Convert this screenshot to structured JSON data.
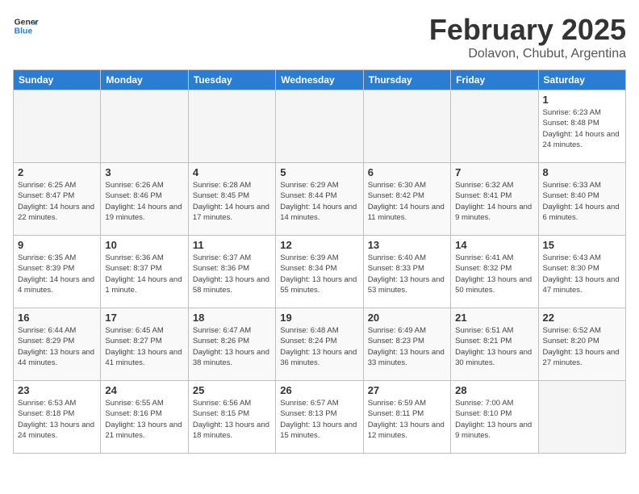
{
  "header": {
    "logo_line1": "General",
    "logo_line2": "Blue",
    "title": "February 2025",
    "subtitle": "Dolavon, Chubut, Argentina"
  },
  "weekdays": [
    "Sunday",
    "Monday",
    "Tuesday",
    "Wednesday",
    "Thursday",
    "Friday",
    "Saturday"
  ],
  "weeks": [
    [
      {
        "day": "",
        "info": ""
      },
      {
        "day": "",
        "info": ""
      },
      {
        "day": "",
        "info": ""
      },
      {
        "day": "",
        "info": ""
      },
      {
        "day": "",
        "info": ""
      },
      {
        "day": "",
        "info": ""
      },
      {
        "day": "1",
        "info": "Sunrise: 6:23 AM\nSunset: 8:48 PM\nDaylight: 14 hours and 24 minutes."
      }
    ],
    [
      {
        "day": "2",
        "info": "Sunrise: 6:25 AM\nSunset: 8:47 PM\nDaylight: 14 hours and 22 minutes."
      },
      {
        "day": "3",
        "info": "Sunrise: 6:26 AM\nSunset: 8:46 PM\nDaylight: 14 hours and 19 minutes."
      },
      {
        "day": "4",
        "info": "Sunrise: 6:28 AM\nSunset: 8:45 PM\nDaylight: 14 hours and 17 minutes."
      },
      {
        "day": "5",
        "info": "Sunrise: 6:29 AM\nSunset: 8:44 PM\nDaylight: 14 hours and 14 minutes."
      },
      {
        "day": "6",
        "info": "Sunrise: 6:30 AM\nSunset: 8:42 PM\nDaylight: 14 hours and 11 minutes."
      },
      {
        "day": "7",
        "info": "Sunrise: 6:32 AM\nSunset: 8:41 PM\nDaylight: 14 hours and 9 minutes."
      },
      {
        "day": "8",
        "info": "Sunrise: 6:33 AM\nSunset: 8:40 PM\nDaylight: 14 hours and 6 minutes."
      }
    ],
    [
      {
        "day": "9",
        "info": "Sunrise: 6:35 AM\nSunset: 8:39 PM\nDaylight: 14 hours and 4 minutes."
      },
      {
        "day": "10",
        "info": "Sunrise: 6:36 AM\nSunset: 8:37 PM\nDaylight: 14 hours and 1 minute."
      },
      {
        "day": "11",
        "info": "Sunrise: 6:37 AM\nSunset: 8:36 PM\nDaylight: 13 hours and 58 minutes."
      },
      {
        "day": "12",
        "info": "Sunrise: 6:39 AM\nSunset: 8:34 PM\nDaylight: 13 hours and 55 minutes."
      },
      {
        "day": "13",
        "info": "Sunrise: 6:40 AM\nSunset: 8:33 PM\nDaylight: 13 hours and 53 minutes."
      },
      {
        "day": "14",
        "info": "Sunrise: 6:41 AM\nSunset: 8:32 PM\nDaylight: 13 hours and 50 minutes."
      },
      {
        "day": "15",
        "info": "Sunrise: 6:43 AM\nSunset: 8:30 PM\nDaylight: 13 hours and 47 minutes."
      }
    ],
    [
      {
        "day": "16",
        "info": "Sunrise: 6:44 AM\nSunset: 8:29 PM\nDaylight: 13 hours and 44 minutes."
      },
      {
        "day": "17",
        "info": "Sunrise: 6:45 AM\nSunset: 8:27 PM\nDaylight: 13 hours and 41 minutes."
      },
      {
        "day": "18",
        "info": "Sunrise: 6:47 AM\nSunset: 8:26 PM\nDaylight: 13 hours and 38 minutes."
      },
      {
        "day": "19",
        "info": "Sunrise: 6:48 AM\nSunset: 8:24 PM\nDaylight: 13 hours and 36 minutes."
      },
      {
        "day": "20",
        "info": "Sunrise: 6:49 AM\nSunset: 8:23 PM\nDaylight: 13 hours and 33 minutes."
      },
      {
        "day": "21",
        "info": "Sunrise: 6:51 AM\nSunset: 8:21 PM\nDaylight: 13 hours and 30 minutes."
      },
      {
        "day": "22",
        "info": "Sunrise: 6:52 AM\nSunset: 8:20 PM\nDaylight: 13 hours and 27 minutes."
      }
    ],
    [
      {
        "day": "23",
        "info": "Sunrise: 6:53 AM\nSunset: 8:18 PM\nDaylight: 13 hours and 24 minutes."
      },
      {
        "day": "24",
        "info": "Sunrise: 6:55 AM\nSunset: 8:16 PM\nDaylight: 13 hours and 21 minutes."
      },
      {
        "day": "25",
        "info": "Sunrise: 6:56 AM\nSunset: 8:15 PM\nDaylight: 13 hours and 18 minutes."
      },
      {
        "day": "26",
        "info": "Sunrise: 6:57 AM\nSunset: 8:13 PM\nDaylight: 13 hours and 15 minutes."
      },
      {
        "day": "27",
        "info": "Sunrise: 6:59 AM\nSunset: 8:11 PM\nDaylight: 13 hours and 12 minutes."
      },
      {
        "day": "28",
        "info": "Sunrise: 7:00 AM\nSunset: 8:10 PM\nDaylight: 13 hours and 9 minutes."
      },
      {
        "day": "",
        "info": ""
      }
    ]
  ]
}
